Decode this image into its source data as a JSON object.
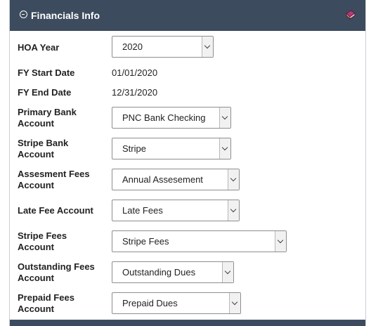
{
  "header": {
    "title": "Financials Info",
    "collapse_icon": "minus-circle-icon",
    "help_icon": "book-icon"
  },
  "colors": {
    "header_bg": "#3d4b5e",
    "header_text": "#ffffff"
  },
  "fields": {
    "hoa_year": {
      "label": "HOA Year",
      "value": "2020"
    },
    "fy_start": {
      "label": "FY Start Date",
      "value": "01/01/2020"
    },
    "fy_end": {
      "label": "FY End Date",
      "value": "12/31/2020"
    },
    "primary_bank": {
      "label_line1": "Primary Bank",
      "label_line2": "Account",
      "value": "PNC Bank Checking"
    },
    "stripe_bank": {
      "label_line1": "Stripe Bank",
      "label_line2": "Account",
      "value": "Stripe"
    },
    "assessment_fees": {
      "label_line1": "Assesment Fees",
      "label_line2": "Account",
      "value": "Annual Assesement"
    },
    "late_fee": {
      "label": "Late Fee Account",
      "value": "Late Fees"
    },
    "stripe_fees": {
      "label_line1": "Stripe Fees",
      "label_line2": "Account",
      "value": "Stripe Fees"
    },
    "outstanding_fees": {
      "label_line1": "Outstanding Fees",
      "label_line2": "Account",
      "value": "Outstanding Dues"
    },
    "prepaid_fees": {
      "label_line1": "Prepaid Fees",
      "label_line2": "Account",
      "value": "Prepaid Dues"
    }
  }
}
